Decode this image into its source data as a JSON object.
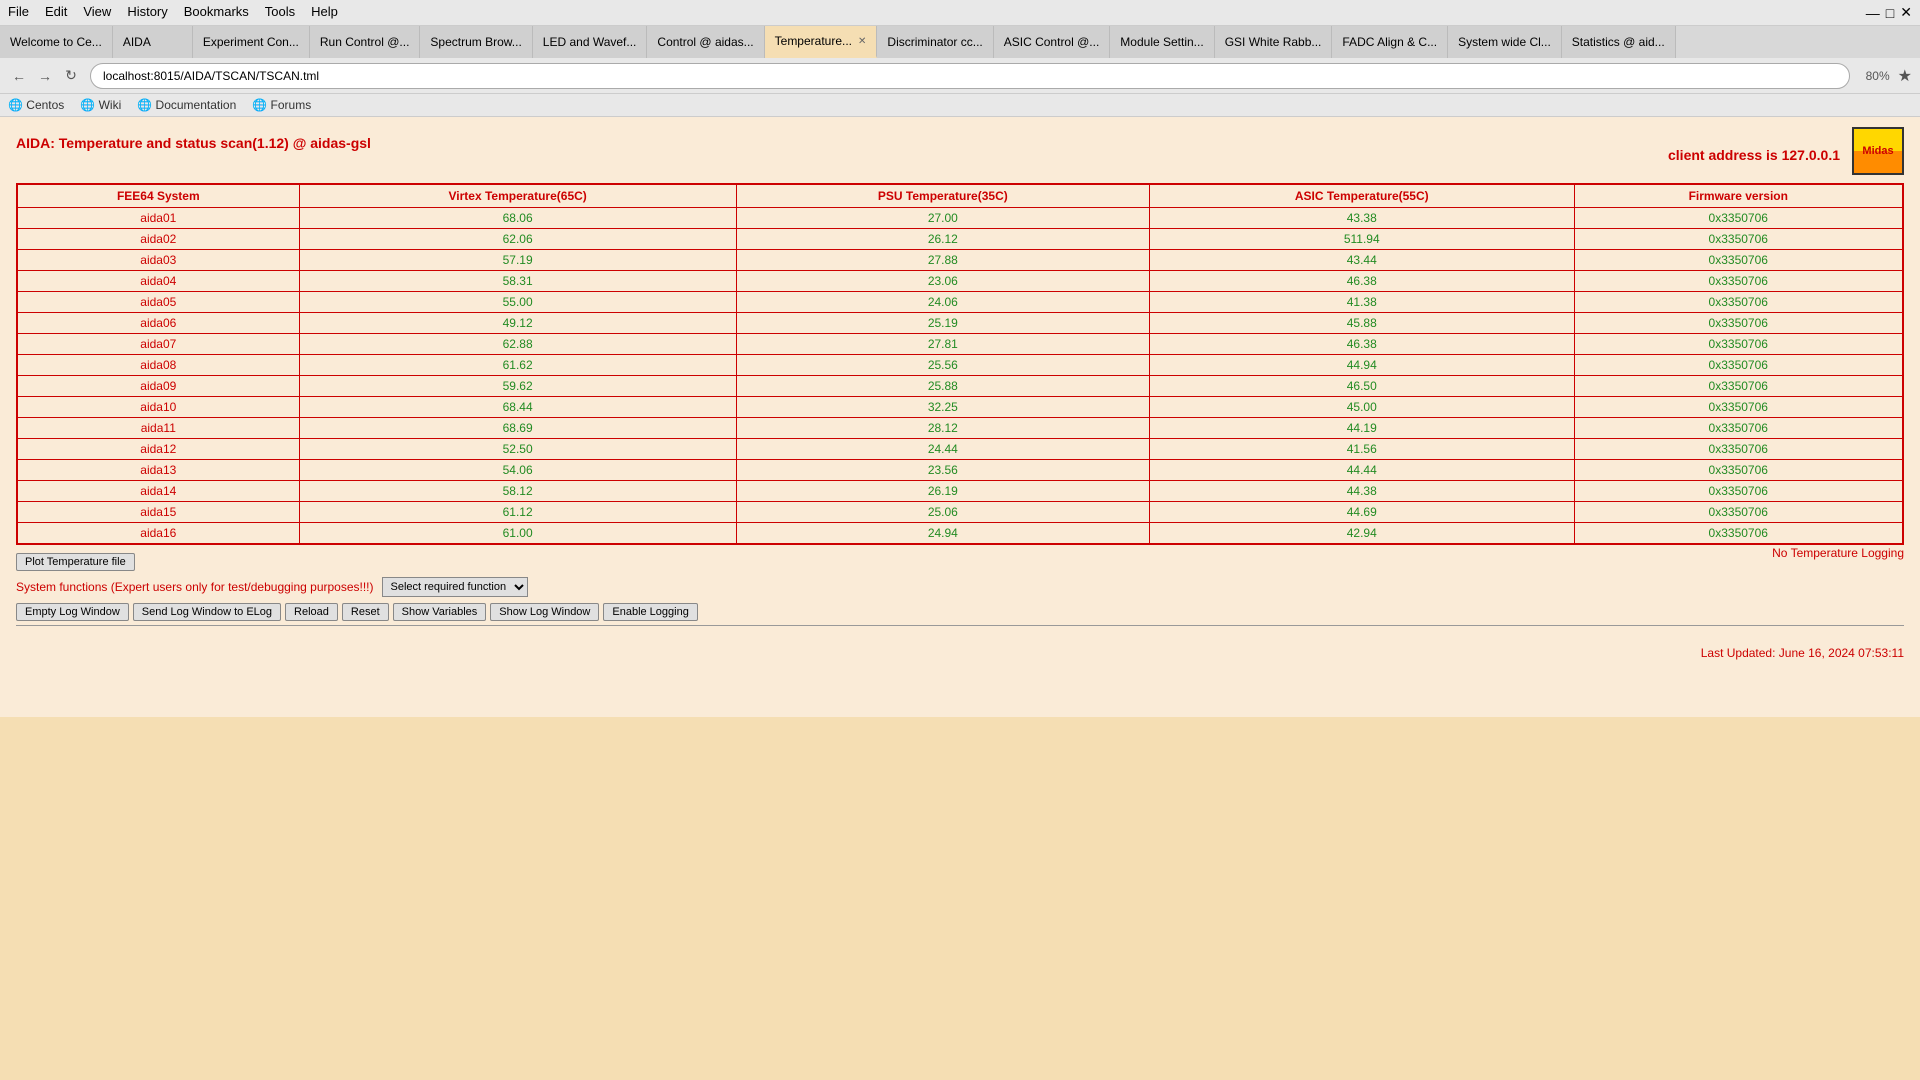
{
  "browser": {
    "menu_items": [
      "File",
      "Edit",
      "View",
      "History",
      "Bookmarks",
      "Tools",
      "Help"
    ],
    "tabs": [
      {
        "label": "Welcome to Ce...",
        "active": false
      },
      {
        "label": "AIDA",
        "active": false
      },
      {
        "label": "Experiment Con...",
        "active": false
      },
      {
        "label": "Run Control @...",
        "active": false
      },
      {
        "label": "Spectrum Brow...",
        "active": false
      },
      {
        "label": "LED and Wavef...",
        "active": false
      },
      {
        "label": "Control @ aidas...",
        "active": false
      },
      {
        "label": "Temperature...",
        "active": true,
        "closeable": true
      },
      {
        "label": "Discriminator cc...",
        "active": false
      },
      {
        "label": "ASIC Control @...",
        "active": false
      },
      {
        "label": "Module Settin...",
        "active": false
      },
      {
        "label": "GSI White Rabb...",
        "active": false
      },
      {
        "label": "FADC Align &  C...",
        "active": false
      },
      {
        "label": "System wide Cl...",
        "active": false
      },
      {
        "label": "Statistics @ aid...",
        "active": false
      }
    ],
    "url": "localhost:8015/AIDA/TSCAN/TSCAN.tml",
    "zoom": "80%",
    "bookmarks": [
      {
        "label": "Centos",
        "icon": "globe"
      },
      {
        "label": "Wiki",
        "icon": "globe"
      },
      {
        "label": "Documentation",
        "icon": "globe"
      },
      {
        "label": "Forums",
        "icon": "globe"
      }
    ]
  },
  "page": {
    "title": "AIDA: Temperature and status scan(1.12) @ aidas-gsl",
    "client_address_label": "client address is 127.0.0.1",
    "table": {
      "headers": [
        "FEE64 System",
        "Virtex Temperature(65C)",
        "PSU Temperature(35C)",
        "ASIC Temperature(55C)",
        "Firmware version"
      ],
      "rows": [
        [
          "aida01",
          "68.06",
          "27.00",
          "43.38",
          "0x3350706"
        ],
        [
          "aida02",
          "62.06",
          "26.12",
          "511.94",
          "0x3350706"
        ],
        [
          "aida03",
          "57.19",
          "27.88",
          "43.44",
          "0x3350706"
        ],
        [
          "aida04",
          "58.31",
          "23.06",
          "46.38",
          "0x3350706"
        ],
        [
          "aida05",
          "55.00",
          "24.06",
          "41.38",
          "0x3350706"
        ],
        [
          "aida06",
          "49.12",
          "25.19",
          "45.88",
          "0x3350706"
        ],
        [
          "aida07",
          "62.88",
          "27.81",
          "46.38",
          "0x3350706"
        ],
        [
          "aida08",
          "61.62",
          "25.56",
          "44.94",
          "0x3350706"
        ],
        [
          "aida09",
          "59.62",
          "25.88",
          "46.50",
          "0x3350706"
        ],
        [
          "aida10",
          "68.44",
          "32.25",
          "45.00",
          "0x3350706"
        ],
        [
          "aida11",
          "68.69",
          "28.12",
          "44.19",
          "0x3350706"
        ],
        [
          "aida12",
          "52.50",
          "24.44",
          "41.56",
          "0x3350706"
        ],
        [
          "aida13",
          "54.06",
          "23.56",
          "44.44",
          "0x3350706"
        ],
        [
          "aida14",
          "58.12",
          "26.19",
          "44.38",
          "0x3350706"
        ],
        [
          "aida15",
          "61.12",
          "25.06",
          "44.69",
          "0x3350706"
        ],
        [
          "aida16",
          "61.00",
          "24.94",
          "42.94",
          "0x3350706"
        ]
      ]
    },
    "controls": {
      "plot_button": "Plot Temperature file",
      "no_logging": "No Temperature Logging",
      "system_functions_label": "System functions (Expert users only for test/debugging purposes!!!)",
      "select_placeholder": "Select required function",
      "buttons": [
        "Empty Log Window",
        "Send Log Window to ELog",
        "Reload",
        "Reset",
        "Show Variables",
        "Show Log Window",
        "Enable Logging"
      ]
    },
    "last_updated": "Last Updated: June 16, 2024 07:53:11"
  }
}
